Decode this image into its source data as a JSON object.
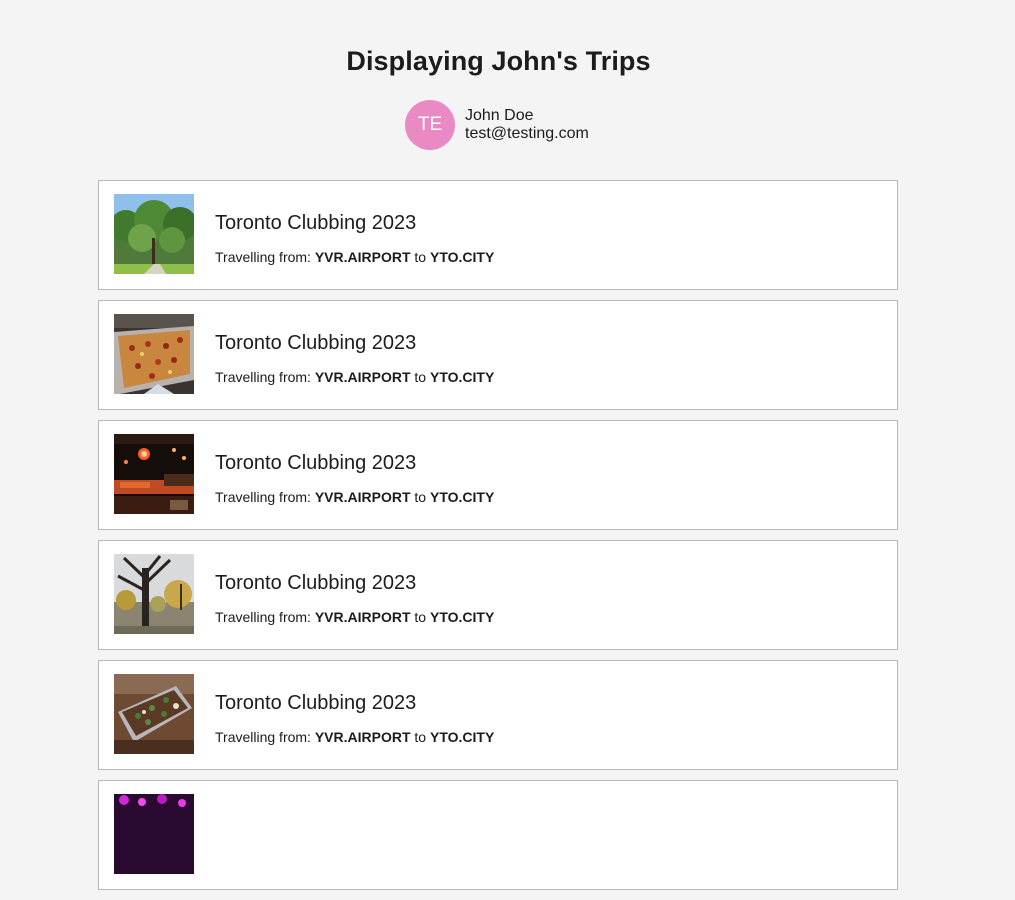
{
  "header": {
    "title": "Displaying John's Trips"
  },
  "user": {
    "initials": "TE",
    "name": "John Doe",
    "email": "test@testing.com"
  },
  "trips": [
    {
      "title": "Toronto Clubbing 2023",
      "route_prefix": "Travelling from:",
      "from": "YVR.AIRPORT",
      "connector": "to",
      "to": "YTO.CITY",
      "image": "park-trees-photo"
    },
    {
      "title": "Toronto Clubbing 2023",
      "route_prefix": "Travelling from:",
      "from": "YVR.AIRPORT",
      "connector": "to",
      "to": "YTO.CITY",
      "image": "pizza-photo"
    },
    {
      "title": "Toronto Clubbing 2023",
      "route_prefix": "Travelling from:",
      "from": "YVR.AIRPORT",
      "connector": "to",
      "to": "YTO.CITY",
      "image": "nightclub-photo"
    },
    {
      "title": "Toronto Clubbing 2023",
      "route_prefix": "Travelling from:",
      "from": "YVR.AIRPORT",
      "connector": "to",
      "to": "YTO.CITY",
      "image": "autumn-street-photo"
    },
    {
      "title": "Toronto Clubbing 2023",
      "route_prefix": "Travelling from:",
      "from": "YVR.AIRPORT",
      "connector": "to",
      "to": "YTO.CITY",
      "image": "food-tray-photo"
    },
    {
      "title": "",
      "route_prefix": "",
      "from": "",
      "connector": "",
      "to": "",
      "image": "purple-lights-photo"
    }
  ]
}
